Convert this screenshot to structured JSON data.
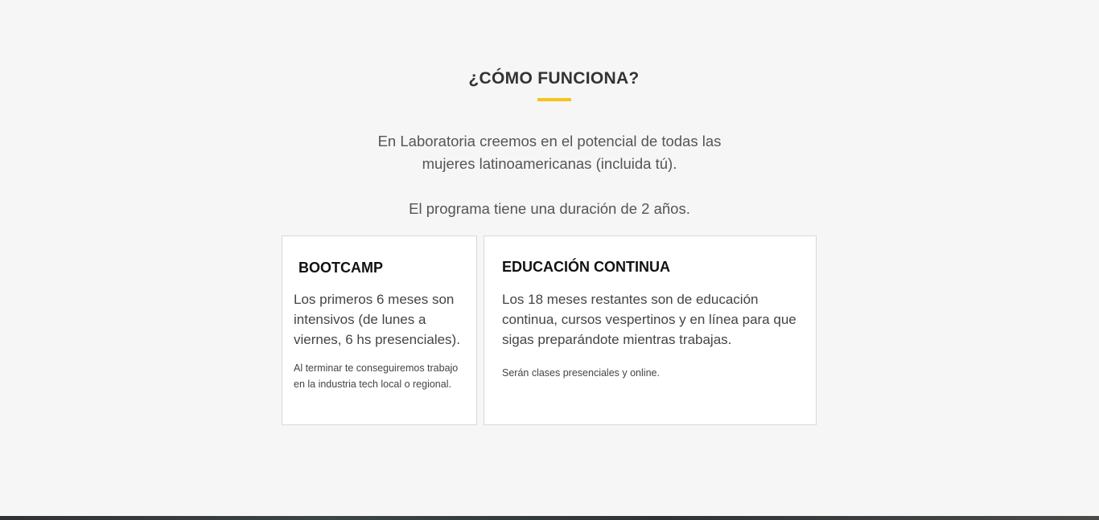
{
  "section": {
    "title": "¿CÓMO FUNCIONA?",
    "intro_line1": "En Laboratoria creemos en el potencial de todas las",
    "intro_line2": "mujeres latinoamericanas (incluida tú).",
    "duration": "El programa tiene una duración de 2 años.",
    "accent_color": "#f6c31c"
  },
  "cards": [
    {
      "title": "BOOTCAMP",
      "body": "Los primeros 6 meses son intensivos (de lunes a viernes, 6 hs presenciales).",
      "note": "Al terminar te conseguiremos trabajo en la industria tech local o regional."
    },
    {
      "title": "EDUCACIÓN CONTINUA",
      "body": "Los 18 meses restantes son de educación continua, cursos vespertinos y en línea para que sigas preparándote mientras trabajas.",
      "note": "Serán clases presenciales y online."
    }
  ]
}
